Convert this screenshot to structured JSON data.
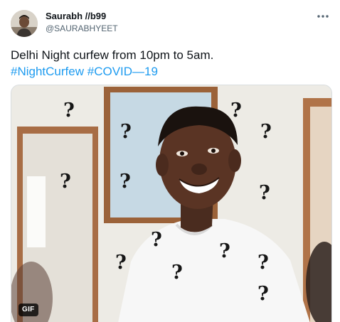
{
  "tweet": {
    "author": {
      "display_name": "Saurabh //b99",
      "handle": "@SAURABHYEET"
    },
    "text_line": "Delhi Night curfew from 10pm to 5am.",
    "hashtags": [
      "#NightCurfew",
      "#COVID—19"
    ],
    "media": {
      "type": "gif",
      "badge": "GIF",
      "overlay_glyph": "?"
    },
    "icons": {
      "more": "more-horizontal-icon"
    }
  },
  "colors": {
    "hashtag": "#1d9bf0",
    "text": "#0f1419",
    "secondary": "#536471"
  }
}
